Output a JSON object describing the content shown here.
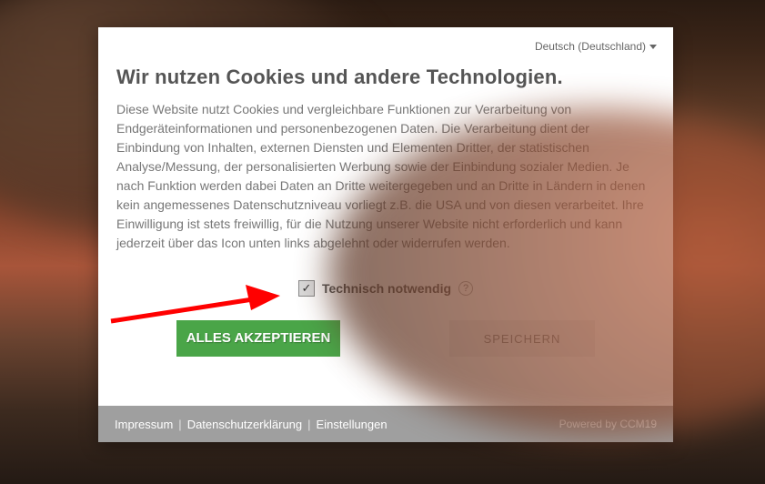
{
  "language": {
    "label": "Deutsch (Deutschland)"
  },
  "title": "Wir nutzen Cookies und andere Technologien.",
  "description": "Diese Website nutzt Cookies und vergleichbare Funktionen zur Verarbeitung von Endgeräteinformationen und personenbezogenen Daten. Die Verarbeitung dient der Einbindung von Inhalten, externen Diensten und Elementen Dritter, der statistischen Analyse/Messung, der personalisierten Werbung sowie der Einbindung sozialer Medien. Je nach Funktion werden dabei Daten an Dritte weitergegeben und an Dritte in Ländern in denen kein angemessenes Datenschutzniveau vorliegt z.B. die USA und von diesen verarbeitet. Ihre Einwilligung ist stets freiwillig, für die Nutzung unserer Website nicht erforderlich und kann jederzeit über das Icon unten links abgelehnt oder widerrufen werden.",
  "checkbox": {
    "label": "Technisch notwendig",
    "checked": true,
    "help": "?"
  },
  "buttons": {
    "accept": "ALLES AKZEPTIEREN",
    "save": "SPEICHERN"
  },
  "footer": {
    "links": [
      "Impressum",
      "Datenschutzerklärung",
      "Einstellungen"
    ],
    "powered": "Powered by CCM19"
  }
}
